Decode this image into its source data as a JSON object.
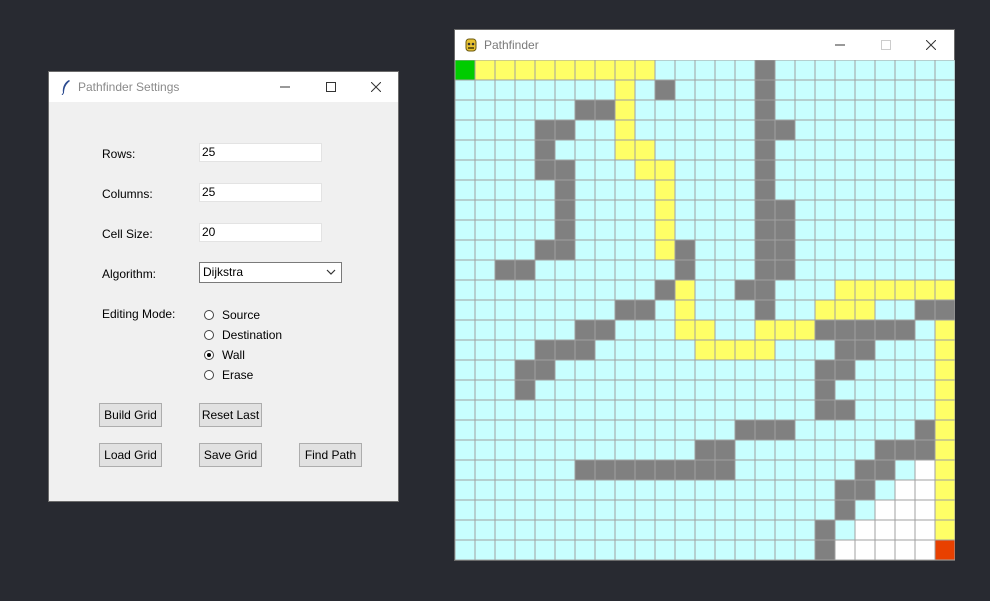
{
  "settings_window": {
    "title": "Pathfinder Settings",
    "fields": {
      "rows_label": "Rows:",
      "rows_value": "25",
      "columns_label": "Columns:",
      "columns_value": "25",
      "cell_size_label": "Cell Size:",
      "cell_size_value": "20",
      "algorithm_label": "Algorithm:",
      "algorithm_value": "Dijkstra",
      "editing_mode_label": "Editing Mode:"
    },
    "modes": [
      {
        "label": "Source",
        "selected": false
      },
      {
        "label": "Destination",
        "selected": false
      },
      {
        "label": "Wall",
        "selected": true
      },
      {
        "label": "Erase",
        "selected": false
      }
    ],
    "buttons": {
      "build_grid": "Build Grid",
      "reset_last": "Reset Last",
      "load_grid": "Load Grid",
      "save_grid": "Save Grid",
      "find_path": "Find Path"
    }
  },
  "pathfinder_window": {
    "title": "Pathfinder",
    "grid": {
      "rows": 25,
      "cols": 25,
      "colors": {
        "empty": "#c8ffff",
        "wall": "#808080",
        "path": "#ffff66",
        "source": "#00cc00",
        "destination": "#e84000",
        "visited": "#ffffff",
        "line": "#a0a0a0"
      },
      "legend": {
        ".": "empty",
        "#": "wall",
        "P": "path",
        "S": "source",
        "D": "destination",
        "W": "visited"
      },
      "cells": [
        "SPPPPPPPPP.....#.........",
        "..........#....#.........",
        "......##.......#.........",
        "....##.........##........",
        "....#..........#.........",
        "....##.........#.........",
        ".....#.........#.........",
        ".....#.........##........",
        ".....#.........##........",
        "....##.....#...##........",
        "..##.......#...##........",
        "..........#...##...PPPPPP",
        "........##.....#.......##",
        "......##..........#####..",
        "....###............##....",
        "...##.............##.....",
        "...#..............#......",
        "..................##.....",
        "..............###......#.",
        "............##.......###.",
        "......########......##.W.",
        "...................##.WW.",
        "...................#.WWW.",
        "..................#.WWWW.",
        "..................#WWWWWD"
      ],
      "path_cells": [
        [
          0,
          1
        ],
        [
          0,
          2
        ],
        [
          0,
          3
        ],
        [
          0,
          4
        ],
        [
          0,
          5
        ],
        [
          0,
          6
        ],
        [
          0,
          7
        ],
        [
          0,
          8
        ],
        [
          0,
          9
        ],
        [
          1,
          8
        ],
        [
          2,
          8
        ],
        [
          3,
          8
        ],
        [
          4,
          8
        ],
        [
          4,
          9
        ],
        [
          5,
          9
        ],
        [
          5,
          10
        ],
        [
          6,
          10
        ],
        [
          7,
          10
        ],
        [
          8,
          10
        ],
        [
          9,
          10
        ],
        [
          9,
          11
        ],
        [
          10,
          11
        ],
        [
          11,
          11
        ],
        [
          12,
          11
        ],
        [
          13,
          11
        ],
        [
          13,
          12
        ],
        [
          14,
          12
        ],
        [
          14,
          13
        ],
        [
          14,
          14
        ],
        [
          14,
          15
        ],
        [
          13,
          15
        ],
        [
          13,
          16
        ],
        [
          13,
          17
        ],
        [
          13,
          18
        ],
        [
          12,
          18
        ],
        [
          12,
          19
        ],
        [
          12,
          20
        ],
        [
          11,
          20
        ],
        [
          11,
          21
        ],
        [
          11,
          22
        ],
        [
          11,
          23
        ],
        [
          11,
          24
        ],
        [
          12,
          24
        ],
        [
          13,
          24
        ],
        [
          14,
          24
        ],
        [
          15,
          24
        ],
        [
          16,
          24
        ],
        [
          17,
          24
        ],
        [
          18,
          24
        ],
        [
          19,
          24
        ],
        [
          20,
          24
        ],
        [
          21,
          24
        ],
        [
          22,
          24
        ],
        [
          23,
          24
        ]
      ]
    }
  }
}
